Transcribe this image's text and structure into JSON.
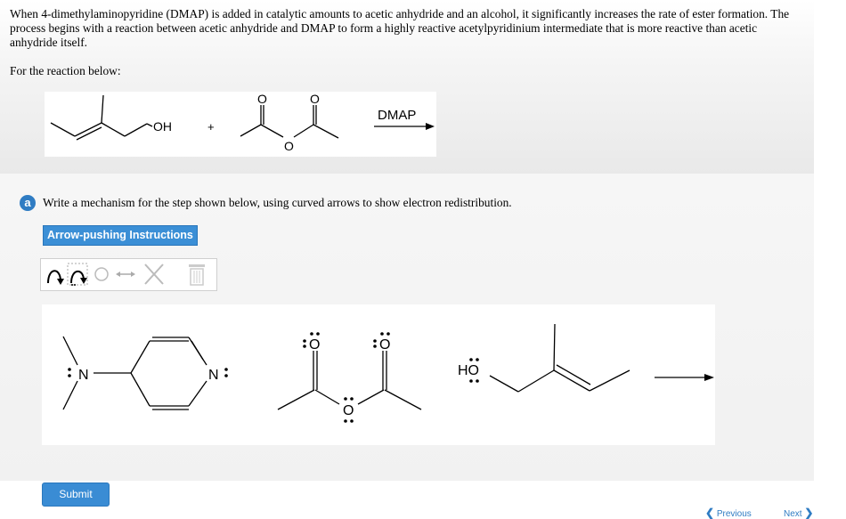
{
  "intro": {
    "text": "When 4-dimethylaminopyridine (DMAP) is added in catalytic amounts to acetic anhydride and an alcohol, it significantly increases the rate of ester formation. The process begins with a reaction between acetic anhydride and DMAP to form a highly reactive acetylpyridinium intermediate that is more reactive than acetic anhydride itself.",
    "for_reaction": "For the reaction below:"
  },
  "reaction": {
    "alcohol_label": "OH",
    "plus": "+",
    "anhydride_o_top_left": "O",
    "anhydride_o_top_right": "O",
    "anhydride_o_bridge": "O",
    "reagent": "DMAP"
  },
  "part_a": {
    "badge": "a",
    "instruction": "Write a mechanism for the step shown below, using curved arrows to show electron redistribution.",
    "arrow_button": "Arrow-pushing Instructions"
  },
  "toolbar": {
    "tools": [
      "curved-arrow-tool",
      "single-electron-arrow-tool",
      "lasso-tool",
      "resonance-arrow-tool",
      "delete-tool",
      "clear-tool"
    ]
  },
  "canvas": {
    "dmap_amine_n": "N",
    "dmap_ring_n": "N",
    "anhydride_o_left": "O",
    "anhydride_o_right": "O",
    "anhydride_o_bridge": "O",
    "alcohol_label": "HO"
  },
  "footer": {
    "submit": "Submit",
    "previous": "Previous",
    "next": "Next"
  },
  "colors": {
    "accent": "#2f7cc3",
    "button": "#3a8cd4"
  }
}
